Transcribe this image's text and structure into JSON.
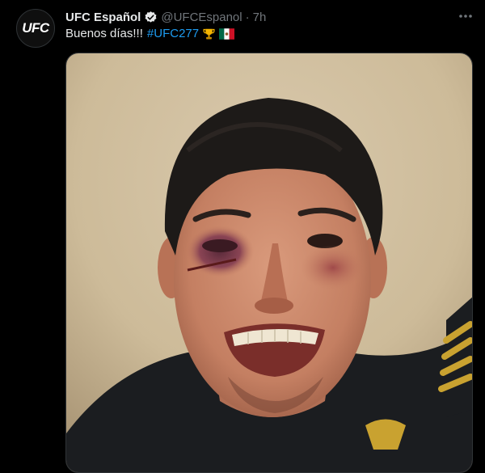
{
  "tweet": {
    "avatar_label": "UFC",
    "display_name": "UFC Español",
    "handle": "@UFCEspanol",
    "separator": "·",
    "time": "7h",
    "text": "Buenos días!!!",
    "hashtag": "#UFC277",
    "emojis": [
      "trophy-icon",
      "mexico-flag-icon"
    ]
  },
  "icons": {
    "verified": "verified-badge-icon",
    "more": "more-options-icon"
  },
  "colors": {
    "background": "#000000",
    "text": "#e7e9ea",
    "secondary": "#71767b",
    "link": "#1d9bf0"
  }
}
